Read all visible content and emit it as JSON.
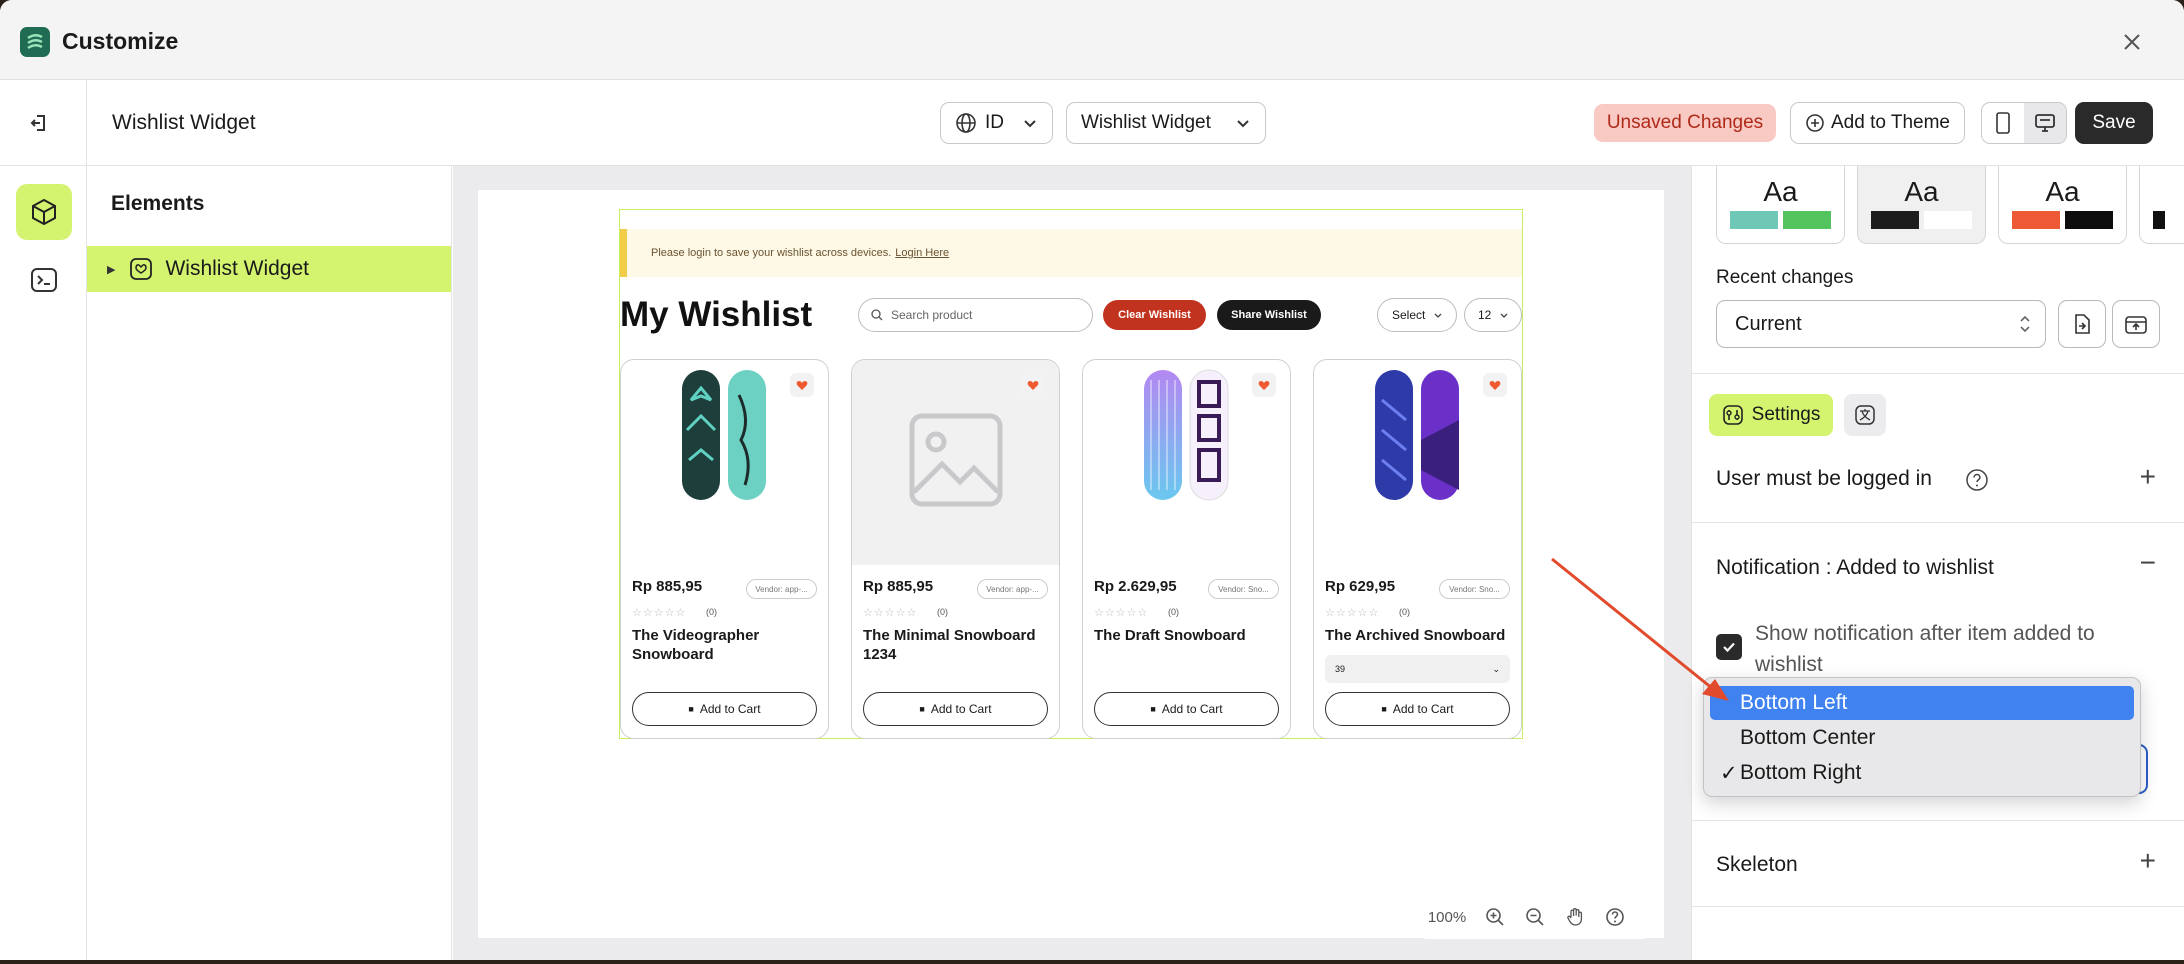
{
  "window": {
    "title": "Customize"
  },
  "header": {
    "page_name": "Wishlist Widget",
    "language": "ID",
    "template": "Wishlist Widget",
    "unsaved": "Unsaved Changes",
    "add_to_theme": "Add to Theme",
    "save": "Save"
  },
  "layers": {
    "title": "Elements",
    "items": [
      {
        "label": "Wishlist Widget",
        "selected": true
      }
    ]
  },
  "preview": {
    "notice": "Please login to save your wishlist across devices.",
    "notice_link": "Login Here",
    "title": "My Wishlist",
    "search_placeholder": "Search product",
    "clear": "Clear Wishlist",
    "share": "Share Wishlist",
    "sort": "Select",
    "per_page": "12",
    "products": [
      {
        "price": "Rp 885,95",
        "vendor": "Vendor: app-...",
        "reviews": "(0)",
        "name": "The Videographer Snowboard",
        "cta": "Add to Cart"
      },
      {
        "price": "Rp 885,95",
        "vendor": "Vendor: app-...",
        "reviews": "(0)",
        "name": "The Minimal Snowboard 1234",
        "cta": "Add to Cart"
      },
      {
        "price": "Rp 2.629,95",
        "vendor": "Vendor: Sno...",
        "reviews": "(0)",
        "name": "The Draft Snowboard",
        "cta": "Add to Cart"
      },
      {
        "price": "Rp 629,95",
        "vendor": "Vendor: Sno...",
        "reviews": "(0)",
        "name": "The Archived Snowboard",
        "variant": "39",
        "cta": "Add to Cart"
      }
    ],
    "stars": "☆☆☆☆☆",
    "zoom": "100%"
  },
  "panel": {
    "swatches": [
      {
        "label": "Aa",
        "colors": [
          "#6fc8b6",
          "#55c45e"
        ]
      },
      {
        "label": "Aa",
        "colors": [
          "#1d1d1d",
          "#ffffff"
        ]
      },
      {
        "label": "Aa",
        "colors": [
          "#ee5a35",
          "#0d0d0d"
        ]
      }
    ],
    "recent_label": "Recent changes",
    "recent_value": "Current",
    "tab_settings": "Settings",
    "sections": {
      "logged_in": "User must be logged in",
      "notification": "Notification : Added to wishlist",
      "skeleton": "Skeleton"
    },
    "show_notification": "Show notification after item added to wishlist"
  },
  "dropdown": {
    "options": [
      {
        "label": "Bottom Left",
        "highlighted": true,
        "checked": false
      },
      {
        "label": "Bottom Center",
        "highlighted": false,
        "checked": false
      },
      {
        "label": "Bottom Right",
        "highlighted": false,
        "checked": true
      }
    ],
    "check_mark": "✓"
  },
  "colors": {
    "accent": "#d4f470",
    "danger": "#c2331f",
    "select_highlight": "#3f82f0",
    "annotation_arrow": "#e24a2c"
  }
}
